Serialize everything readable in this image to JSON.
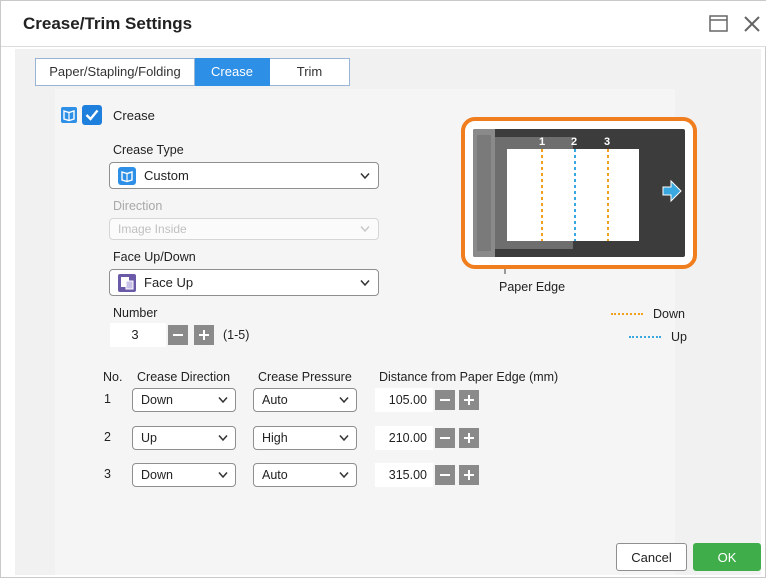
{
  "window": {
    "title": "Crease/Trim Settings"
  },
  "tabs": [
    {
      "label": "Paper/Stapling/Folding",
      "active": false
    },
    {
      "label": "Crease",
      "active": true
    },
    {
      "label": "Trim",
      "active": false
    }
  ],
  "crease": {
    "checkbox_label": "Crease",
    "checked": true
  },
  "crease_type": {
    "label": "Crease Type",
    "value": "Custom",
    "icon": "custom-book-icon"
  },
  "direction": {
    "label": "Direction",
    "value": "Image Inside",
    "disabled": true
  },
  "face": {
    "label": "Face Up/Down",
    "value": "Face Up",
    "icon": "face-up-icon"
  },
  "number": {
    "label": "Number",
    "value": "3",
    "range": "(1-5)"
  },
  "table": {
    "headers": [
      "No.",
      "Crease Direction",
      "Crease Pressure",
      "Distance from Paper Edge (mm)"
    ],
    "rows": [
      {
        "no": "1",
        "direction": "Down",
        "pressure": "Auto",
        "distance": "105.00"
      },
      {
        "no": "2",
        "direction": "Up",
        "pressure": "High",
        "distance": "210.00"
      },
      {
        "no": "3",
        "direction": "Down",
        "pressure": "Auto",
        "distance": "315.00"
      }
    ]
  },
  "preview": {
    "crease_numbers": [
      "1",
      "2",
      "3"
    ],
    "paper_edge_label": "Paper Edge"
  },
  "legend": {
    "down_label": "Down",
    "up_label": "Up",
    "down_color": "#f0a21e",
    "up_color": "#3aa8e0"
  },
  "buttons": {
    "cancel": "Cancel",
    "ok": "OK"
  },
  "colors": {
    "accent": "#2d8fe6",
    "highlight": "#f07e1e",
    "ok": "#3fae4a"
  }
}
